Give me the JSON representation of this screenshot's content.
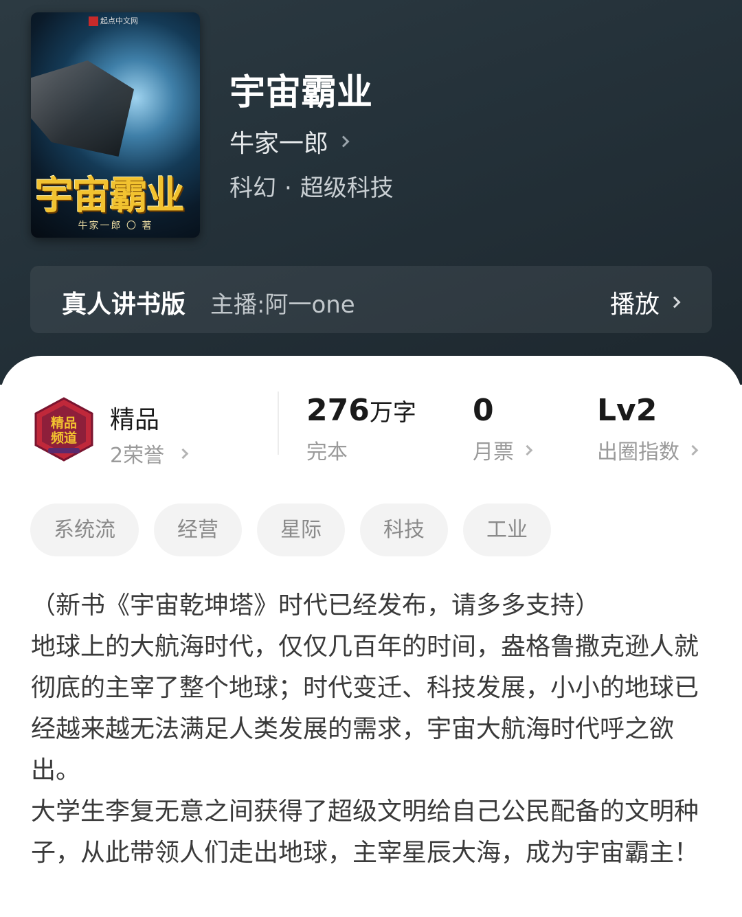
{
  "book": {
    "title": "宇宙霸业",
    "author": "牛家一郎",
    "genre": "科幻",
    "subgenre": "超级科技",
    "separator": "·"
  },
  "cover": {
    "publisher": "起点中文网",
    "title": "宇宙霸业",
    "author_line": "牛家一郎 〇 著"
  },
  "audio": {
    "label": "真人讲书版",
    "host": "主播:阿一one",
    "play_label": "播放"
  },
  "honor": {
    "badge_text": "精品频道",
    "title": "精品",
    "count": "2荣誉"
  },
  "stats": {
    "words_value": "276",
    "words_unit": "万字",
    "words_label": "完本",
    "monthly_value": "0",
    "monthly_label": "月票",
    "level_value": "Lv2",
    "level_label": "出圈指数"
  },
  "tags": [
    "系统流",
    "经营",
    "星际",
    "科技",
    "工业"
  ],
  "description": [
    "（新书《宇宙乾坤塔》时代已经发布，请多多支持）",
    "地球上的大航海时代，仅仅几百年的时间，盎格鲁撒克逊人就彻底的主宰了整个地球；时代变迁、科技发展，小小的地球已经越来越无法满足人类发展的需求，宇宙大航海时代呼之欲出。",
    "大学生李复无意之间获得了超级文明给自己公民配备的文明种子，从此带领人们走出地球，主宰星辰大海，成为宇宙霸主！"
  ],
  "colors": {
    "hero_bg": "#243139",
    "badge_red": "#c0283a",
    "badge_purple": "#5a2a6e",
    "badge_gold": "#f2c230"
  }
}
